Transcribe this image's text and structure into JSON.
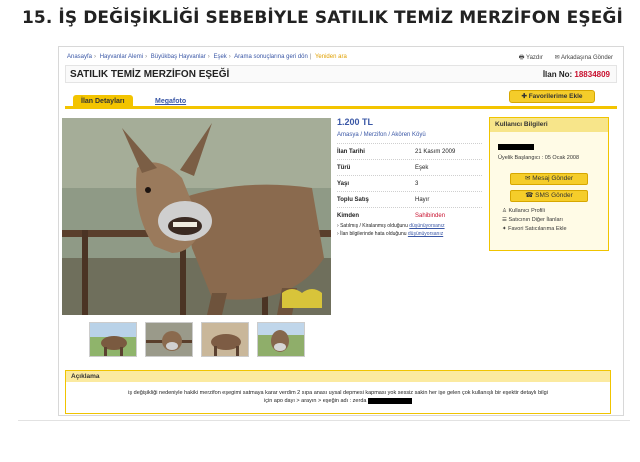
{
  "headline": "15. İŞ DEĞİŞİKLİĞİ SEBEBİYLE SATILIK TEMİZ MERZİFON EŞEĞİ",
  "breadcrumb": {
    "items": [
      "Anasayfa",
      "Hayvanlar Alemi",
      "Büyükbaş Hayvanlar",
      "Eşek",
      "Arama sonuçlarına geri dön"
    ],
    "extra": "Yeniden ara"
  },
  "toplinks": {
    "print": "Yazdır",
    "send": "Arkadaşına Gönder"
  },
  "listing": {
    "title": "SATILIK TEMİZ MERZİFON EŞEĞİ",
    "no_label": "İlan No:",
    "no_value": "18834809"
  },
  "tabs": {
    "details": "İlan Detayları",
    "gallery": "Megafoto"
  },
  "fav_button": "Favorilerime Ekle",
  "price": "1.200 TL",
  "location": "Amasya / Merzifon / Akören Köyü",
  "details": [
    {
      "k": "İlan Tarihi",
      "v": "21 Kasım 2009"
    },
    {
      "k": "Türü",
      "v": "Eşek"
    },
    {
      "k": "Yaşı",
      "v": "3"
    },
    {
      "k": "Toplu Satış",
      "v": "Hayır"
    },
    {
      "k": "Kimden",
      "v": "Sahibinden"
    }
  ],
  "notes": {
    "line1_text": "Satılmış / Kiralanmış olduğunu",
    "line1_link": "düşünüyorsanız",
    "line2_text": "İlan bilgilerinde hata olduğunu",
    "line2_link": "düşünüyorsanız"
  },
  "user": {
    "header": "Kullanıcı Bilgileri",
    "since": "Üyelik Başlangıcı : 05 Ocak 2008",
    "message_button": "Mesaj Gönder",
    "sms_button": "SMS Gönder",
    "links": [
      "Kullanıcı Profili",
      "Satıcının Diğer İlanları",
      "Favori Satıcılarıma Ekle"
    ]
  },
  "description": {
    "header": "Açıklama",
    "text1": "iş değişikliği nedeniyle hakiki merzifon eşegimi satmaya karar verdim 2 sıpa anası uysal depmesi kapması yok sessiz sakin her işe gelen çok kullanışlı bir eşektir detaylı bilgi",
    "text2": "için apo dayı > arayın > eşeğin adı : zerda"
  },
  "colors": {
    "accent": "#f3c400",
    "link": "#3a57a6",
    "red": "#c8102e"
  }
}
